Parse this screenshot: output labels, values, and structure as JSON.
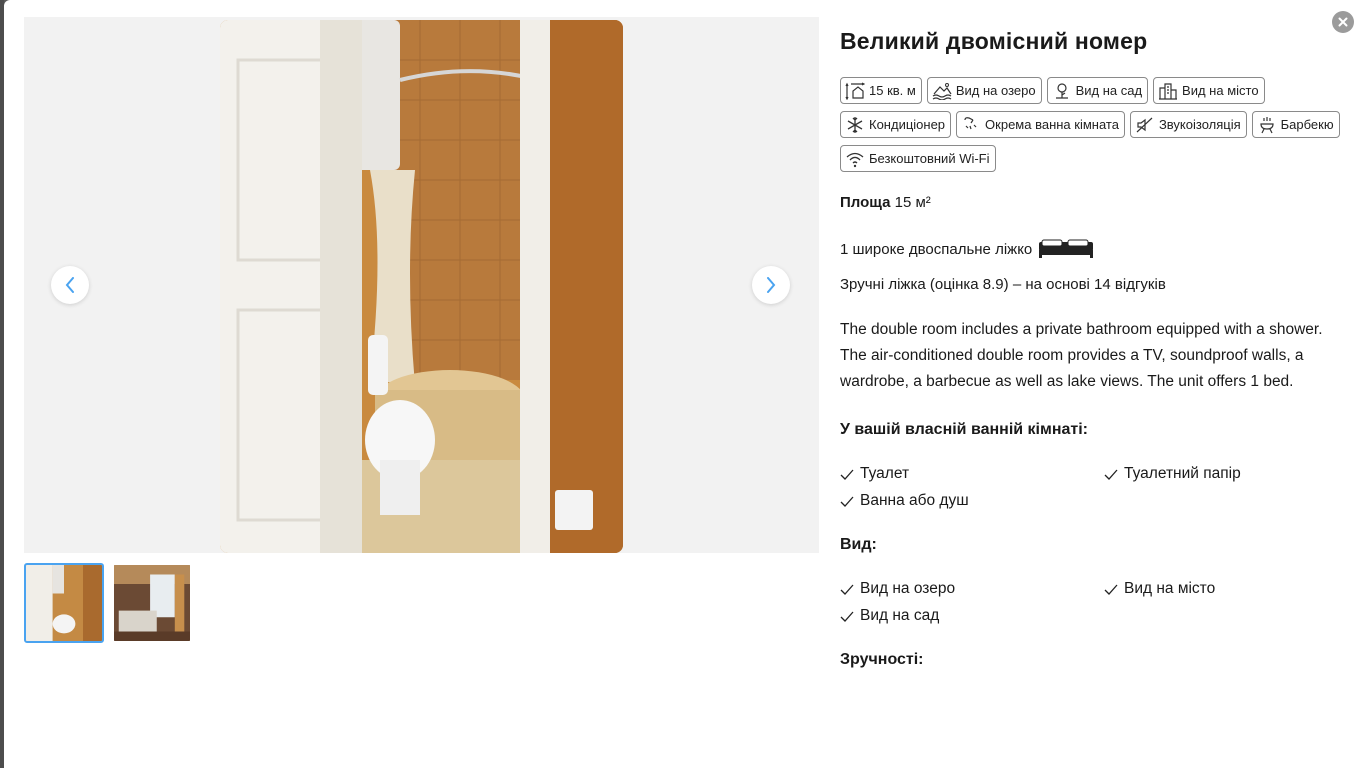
{
  "room": {
    "title": "Великий двомісний номер",
    "facilities": [
      {
        "icon": "area-icon",
        "label": "15 кв. м"
      },
      {
        "icon": "lake-view-icon",
        "label": "Вид на озеро"
      },
      {
        "icon": "garden-view-icon",
        "label": "Вид на сад"
      },
      {
        "icon": "city-view-icon",
        "label": "Вид на місто"
      },
      {
        "icon": "air-conditioning-icon",
        "label": "Кондиціонер"
      },
      {
        "icon": "bathroom-icon",
        "label": "Окрема ванна кімната"
      },
      {
        "icon": "soundproof-icon",
        "label": "Звукоізоляція"
      },
      {
        "icon": "barbecue-icon",
        "label": "Барбекю"
      },
      {
        "icon": "wifi-icon",
        "label": "Безкоштовний Wi-Fi"
      }
    ],
    "area_label": "Площа",
    "area_value": "15 м²",
    "bed_text": "1 широке двоспальне ліжко",
    "rating_text": "Зручні ліжка (оцінка 8.9) – на основі 14 відгуків",
    "description": "The double room includes a private bathroom equipped with a shower. The air-conditioned double room provides a TV, soundproof walls, a wardrobe, a barbecue as well as lake views. The unit offers 1 bed.",
    "bathroom_title": "У вашій власній ванній кімнаті:",
    "bathroom_items": [
      "Туалет",
      "Туалетний папір",
      "Ванна або душ"
    ],
    "view_title": "Вид:",
    "view_items": [
      "Вид на озеро",
      "Вид на місто",
      "Вид на сад"
    ],
    "amenities_title": "Зручності:"
  },
  "gallery": {
    "thumbnails": [
      {
        "name": "thumbnail-bathroom",
        "active": true
      },
      {
        "name": "thumbnail-bedroom",
        "active": false
      }
    ]
  },
  "colors": {
    "accent": "#4aa3f0",
    "chip_border": "#8a8a8a",
    "gallery_bg": "#f2f2f2"
  }
}
